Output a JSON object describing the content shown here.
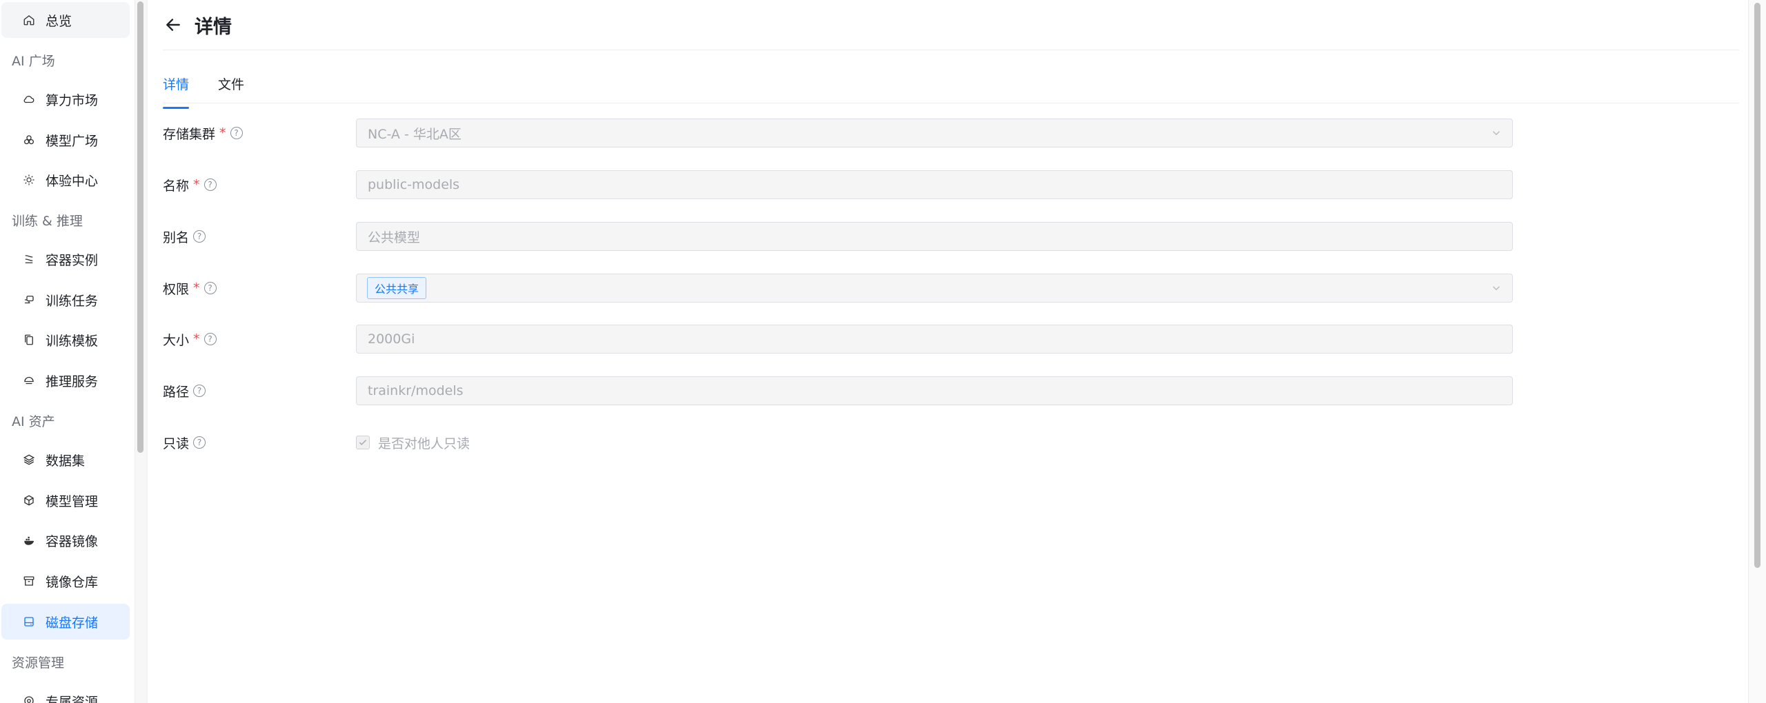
{
  "sidebar": {
    "items": [
      {
        "id": "overview",
        "label": "总览",
        "icon": "home-icon"
      },
      {
        "id": "compute-market",
        "label": "算力市场",
        "icon": "cloud-icon"
      },
      {
        "id": "model-plaza",
        "label": "模型广场",
        "icon": "circles-icon"
      },
      {
        "id": "experience-center",
        "label": "体验中心",
        "icon": "sun-icon"
      },
      {
        "id": "container-instance",
        "label": "容器实例",
        "icon": "terminal-icon"
      },
      {
        "id": "training-task",
        "label": "训练任务",
        "icon": "robot-icon"
      },
      {
        "id": "training-template",
        "label": "训练模板",
        "icon": "copy-icon"
      },
      {
        "id": "inference-service",
        "label": "推理服务",
        "icon": "bowl-icon"
      },
      {
        "id": "dataset",
        "label": "数据集",
        "icon": "layers-icon"
      },
      {
        "id": "model-management",
        "label": "模型管理",
        "icon": "cube-icon"
      },
      {
        "id": "container-image",
        "label": "容器镜像",
        "icon": "whale-icon"
      },
      {
        "id": "image-repository",
        "label": "镜像仓库",
        "icon": "archive-icon"
      },
      {
        "id": "disk-storage",
        "label": "磁盘存储",
        "icon": "disk-icon"
      },
      {
        "id": "dedicated-resource",
        "label": "专属资源",
        "icon": "gear-icon"
      }
    ],
    "groups": {
      "ai_plaza": "AI 广场",
      "training": "训练 & 推理",
      "ai_assets": "AI 资产",
      "resource_mgmt": "资源管理"
    }
  },
  "header": {
    "title": "详情"
  },
  "tabs": [
    {
      "label": "详情",
      "active": true
    },
    {
      "label": "文件",
      "active": false
    }
  ],
  "form": {
    "cluster": {
      "label": "存储集群",
      "value": "NC-A - 华北A区"
    },
    "name": {
      "label": "名称",
      "value": "public-models"
    },
    "alias": {
      "label": "别名",
      "value": "公共模型"
    },
    "permission": {
      "label": "权限",
      "tag": "公共共享"
    },
    "size": {
      "label": "大小",
      "value": "2000Gi"
    },
    "path": {
      "label": "路径",
      "value": "trainkr/models"
    },
    "readonly": {
      "label": "只读",
      "checkbox_label": "是否对他人只读",
      "checked": true
    }
  },
  "colors": {
    "accent": "#1677ff",
    "required": "#e34d59"
  }
}
